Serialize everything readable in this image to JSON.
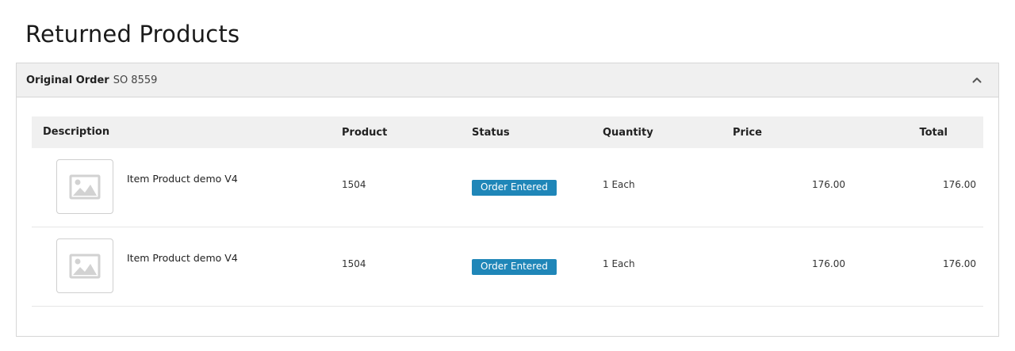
{
  "page": {
    "title": "Returned Products"
  },
  "order": {
    "label": "Original Order",
    "number": "SO 8559",
    "toggle_icon": "chevron-up-icon"
  },
  "table": {
    "headers": [
      "Description",
      "Product",
      "Status",
      "Quantity",
      "Price",
      "Total"
    ],
    "rows": [
      {
        "image_icon": "image-placeholder-icon",
        "description": "Item Product demo V4",
        "product": "1504",
        "status": "Order Entered",
        "quantity": "1 Each",
        "price": "176.00",
        "total": "176.00"
      },
      {
        "image_icon": "image-placeholder-icon",
        "description": "Item Product demo V4",
        "product": "1504",
        "status": "Order Entered",
        "quantity": "1 Each",
        "price": "176.00",
        "total": "176.00"
      }
    ]
  },
  "colors": {
    "status_badge": "#1f86b8",
    "header_background": "#f0f0f0",
    "border": "#d6d6d6"
  }
}
